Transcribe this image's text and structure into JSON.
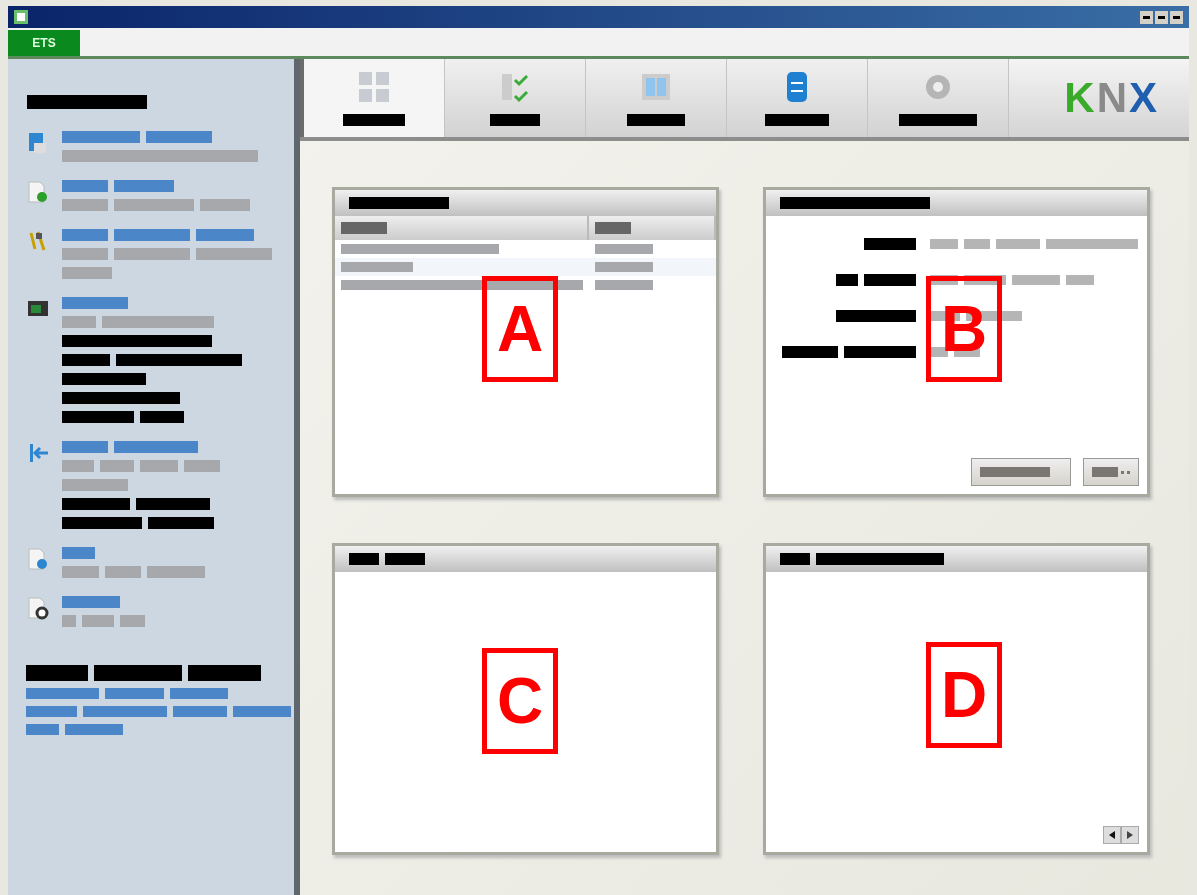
{
  "window": {
    "tab": "ETS"
  },
  "toolbar": {
    "tabs": [
      {
        "kind": "grid",
        "selected": true
      },
      {
        "kind": "checklist",
        "selected": false
      },
      {
        "kind": "book",
        "selected": false
      },
      {
        "kind": "database",
        "selected": false
      },
      {
        "kind": "gear",
        "selected": false
      }
    ],
    "logo": "KNX"
  },
  "sidebar": {
    "items": [
      {
        "kind": "open"
      },
      {
        "kind": "new"
      },
      {
        "kind": "tools"
      },
      {
        "kind": "screen"
      },
      {
        "kind": "import"
      },
      {
        "kind": "globe"
      },
      {
        "kind": "settings"
      }
    ]
  },
  "panels": [
    {
      "marker": "A",
      "kind": "table"
    },
    {
      "marker": "B",
      "kind": "form"
    },
    {
      "marker": "C",
      "kind": "empty"
    },
    {
      "marker": "D",
      "kind": "pager"
    }
  ]
}
